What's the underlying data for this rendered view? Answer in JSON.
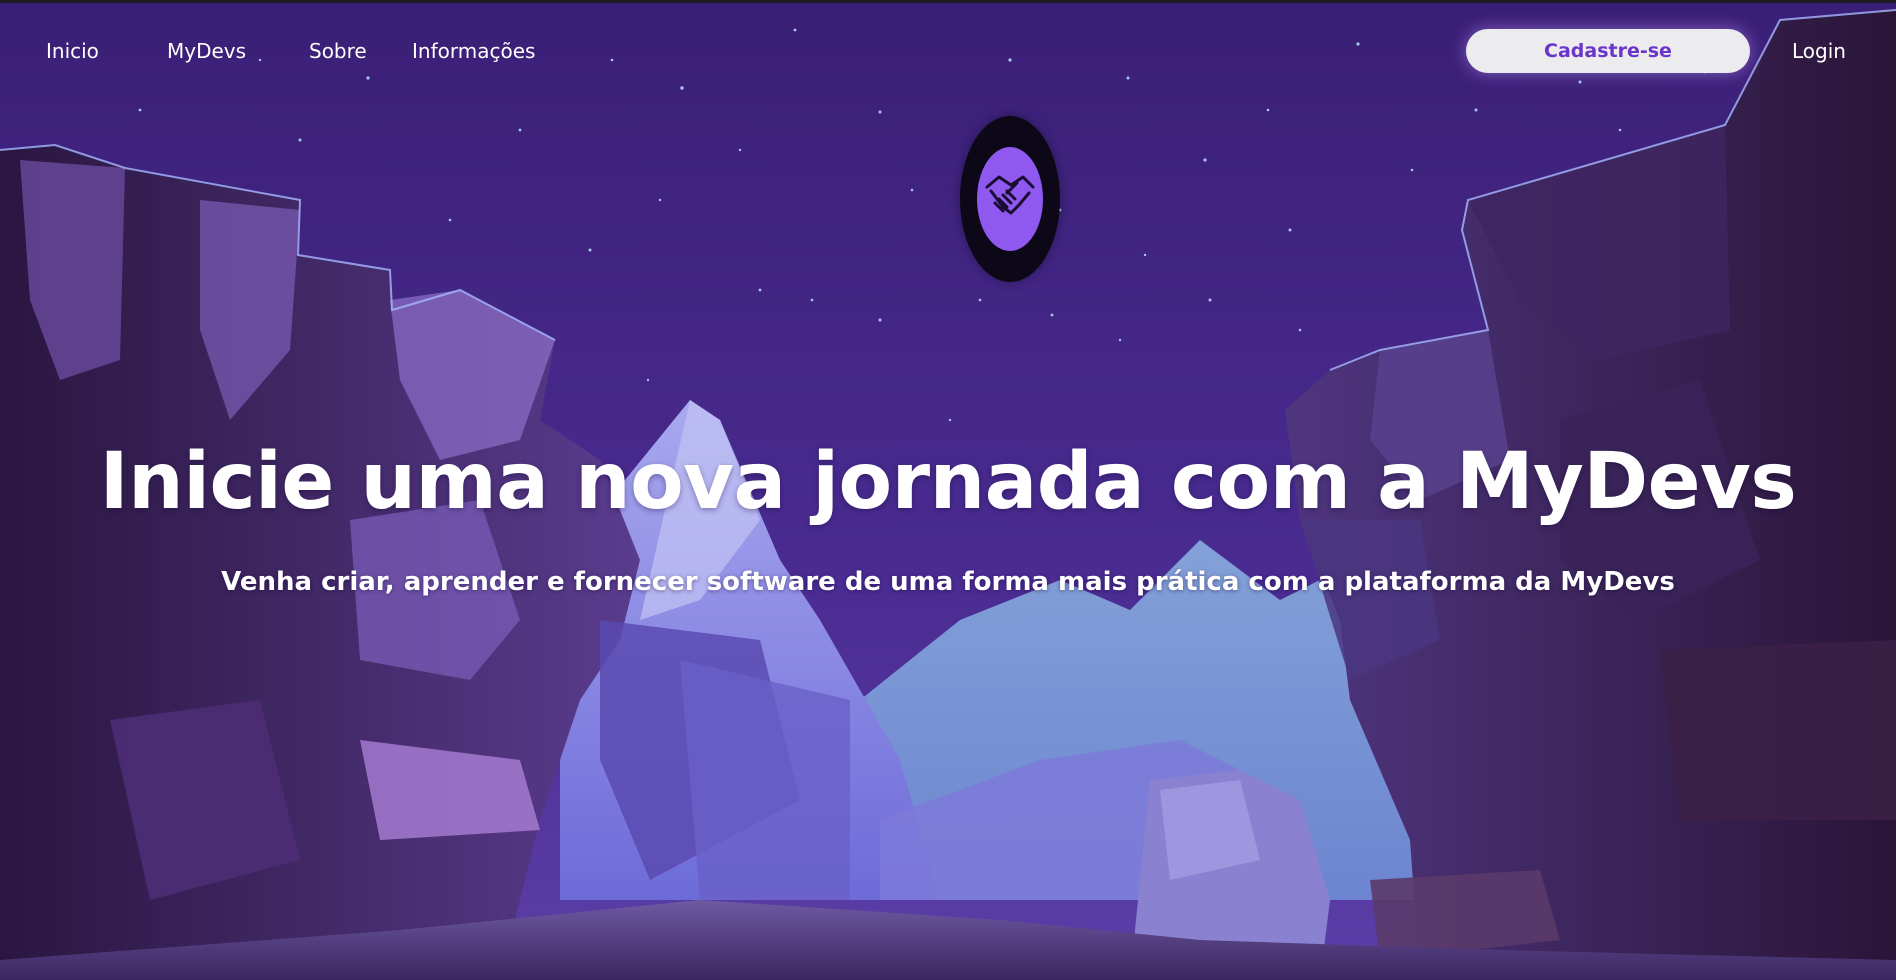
{
  "nav": {
    "links": [
      "Inicio",
      "MyDevs",
      "Sobre",
      "Informações"
    ],
    "signup_label": "Cadastre-se",
    "login_label": "Login"
  },
  "hero": {
    "title": "Inicie uma nova jornada com a MyDevs",
    "subtitle": "Venha criar, aprender e fornecer software de uma forma mais prática com a plataforma da MyDevs"
  },
  "logo": {
    "icon": "handshake-icon"
  },
  "colors": {
    "sky_top": "#3a1f76",
    "sky_bottom": "#4b2e93",
    "accent": "#6a35c9",
    "button_bg": "#ececef",
    "logo_fill": "#8f59ef"
  }
}
